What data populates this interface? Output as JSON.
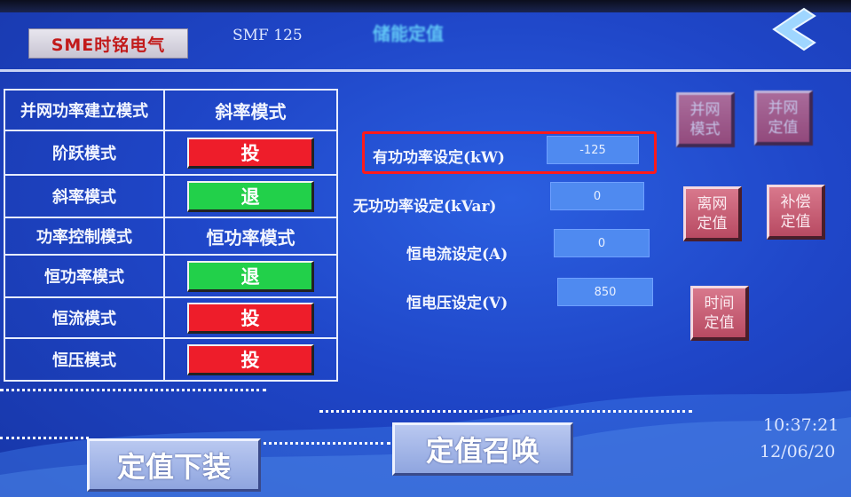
{
  "header": {
    "logo": "SME时铭电气",
    "model": "SMF 125",
    "page_title": "储能定值"
  },
  "mode_table": [
    {
      "label": "并网功率建立模式",
      "value": "斜率模式",
      "kind": "text"
    },
    {
      "label": "阶跃模式",
      "value": "投",
      "kind": "on"
    },
    {
      "label": "斜率模式",
      "value": "退",
      "kind": "off"
    },
    {
      "label": "功率控制模式",
      "value": "恒功率模式",
      "kind": "text"
    },
    {
      "label": "恒功率模式",
      "value": "退",
      "kind": "off"
    },
    {
      "label": "恒流模式",
      "value": "投",
      "kind": "on"
    },
    {
      "label": "恒压模式",
      "value": "投",
      "kind": "on"
    }
  ],
  "settings": {
    "active_power": {
      "label": "有功功率设定(kW)",
      "value": "-125"
    },
    "reactive_power": {
      "label": "无功功率设定(kVar)",
      "value": "0"
    },
    "constant_current": {
      "label": "恒电流设定(A)",
      "value": "0"
    },
    "constant_voltage": {
      "label": "恒电压设定(V)",
      "value": "850"
    }
  },
  "side_buttons": {
    "mode": [
      "并网",
      "模式"
    ],
    "grid_connect": [
      "并网",
      "定值"
    ],
    "off_grid": [
      "离网",
      "定值"
    ],
    "compensation": [
      "补偿",
      "定值"
    ],
    "time": [
      "时间",
      "定值"
    ]
  },
  "actions": {
    "download": "定值下装",
    "recall": "定值召唤"
  },
  "clock": {
    "time": "10:37:21",
    "date": "12/06/20"
  },
  "colors": {
    "background": "#1f46c8",
    "on": "#ee1d2a",
    "off": "#22d04a",
    "highlight": "#ff1a1a"
  }
}
